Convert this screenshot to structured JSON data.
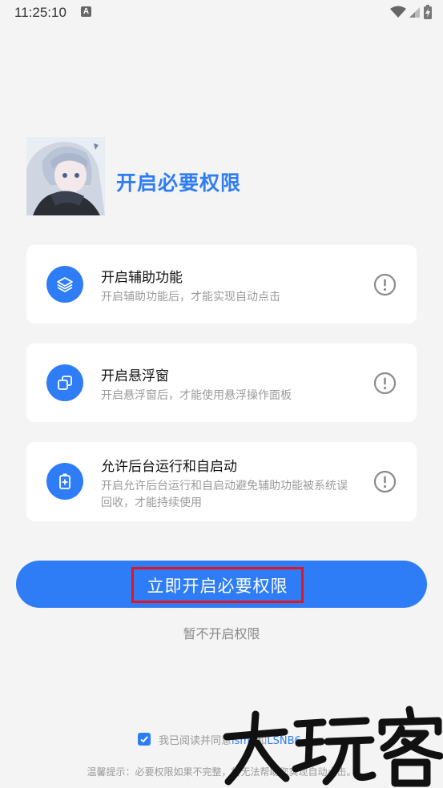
{
  "status_bar": {
    "time": "11:25:10",
    "notification_letter": "A"
  },
  "header": {
    "title": "开启必要权限"
  },
  "permissions": [
    {
      "title": "开启辅助功能",
      "description": "开启辅助功能后，才能实现自动点击",
      "icon": "layers-icon"
    },
    {
      "title": "开启悬浮窗",
      "description": "开启悬浮窗后，才能使用悬浮操作面板",
      "icon": "overlay-windows-icon"
    },
    {
      "title": "允许后台运行和自启动",
      "description": "开启允许后台运行和自启动避免辅助功能被系统误回收，才能持续使用",
      "icon": "battery-plus-icon"
    }
  ],
  "actions": {
    "primary_label": "立即开启必要权限",
    "secondary_label": "暂不开启权限"
  },
  "agreement": {
    "checked": true,
    "prefix": "我已阅读并同意",
    "link1": "lsm",
    "link1_rest": "6",
    "connector": "和",
    "link2": "LSNB",
    "link2_rest": "6"
  },
  "tip": "温馨提示：必要权限如果不完整，将无法帮助您实现自动点击。",
  "watermark": "大玩客",
  "colors": {
    "accent": "#2f7df6",
    "highlight_border": "#e3141e",
    "background": "#f4f4f4"
  }
}
